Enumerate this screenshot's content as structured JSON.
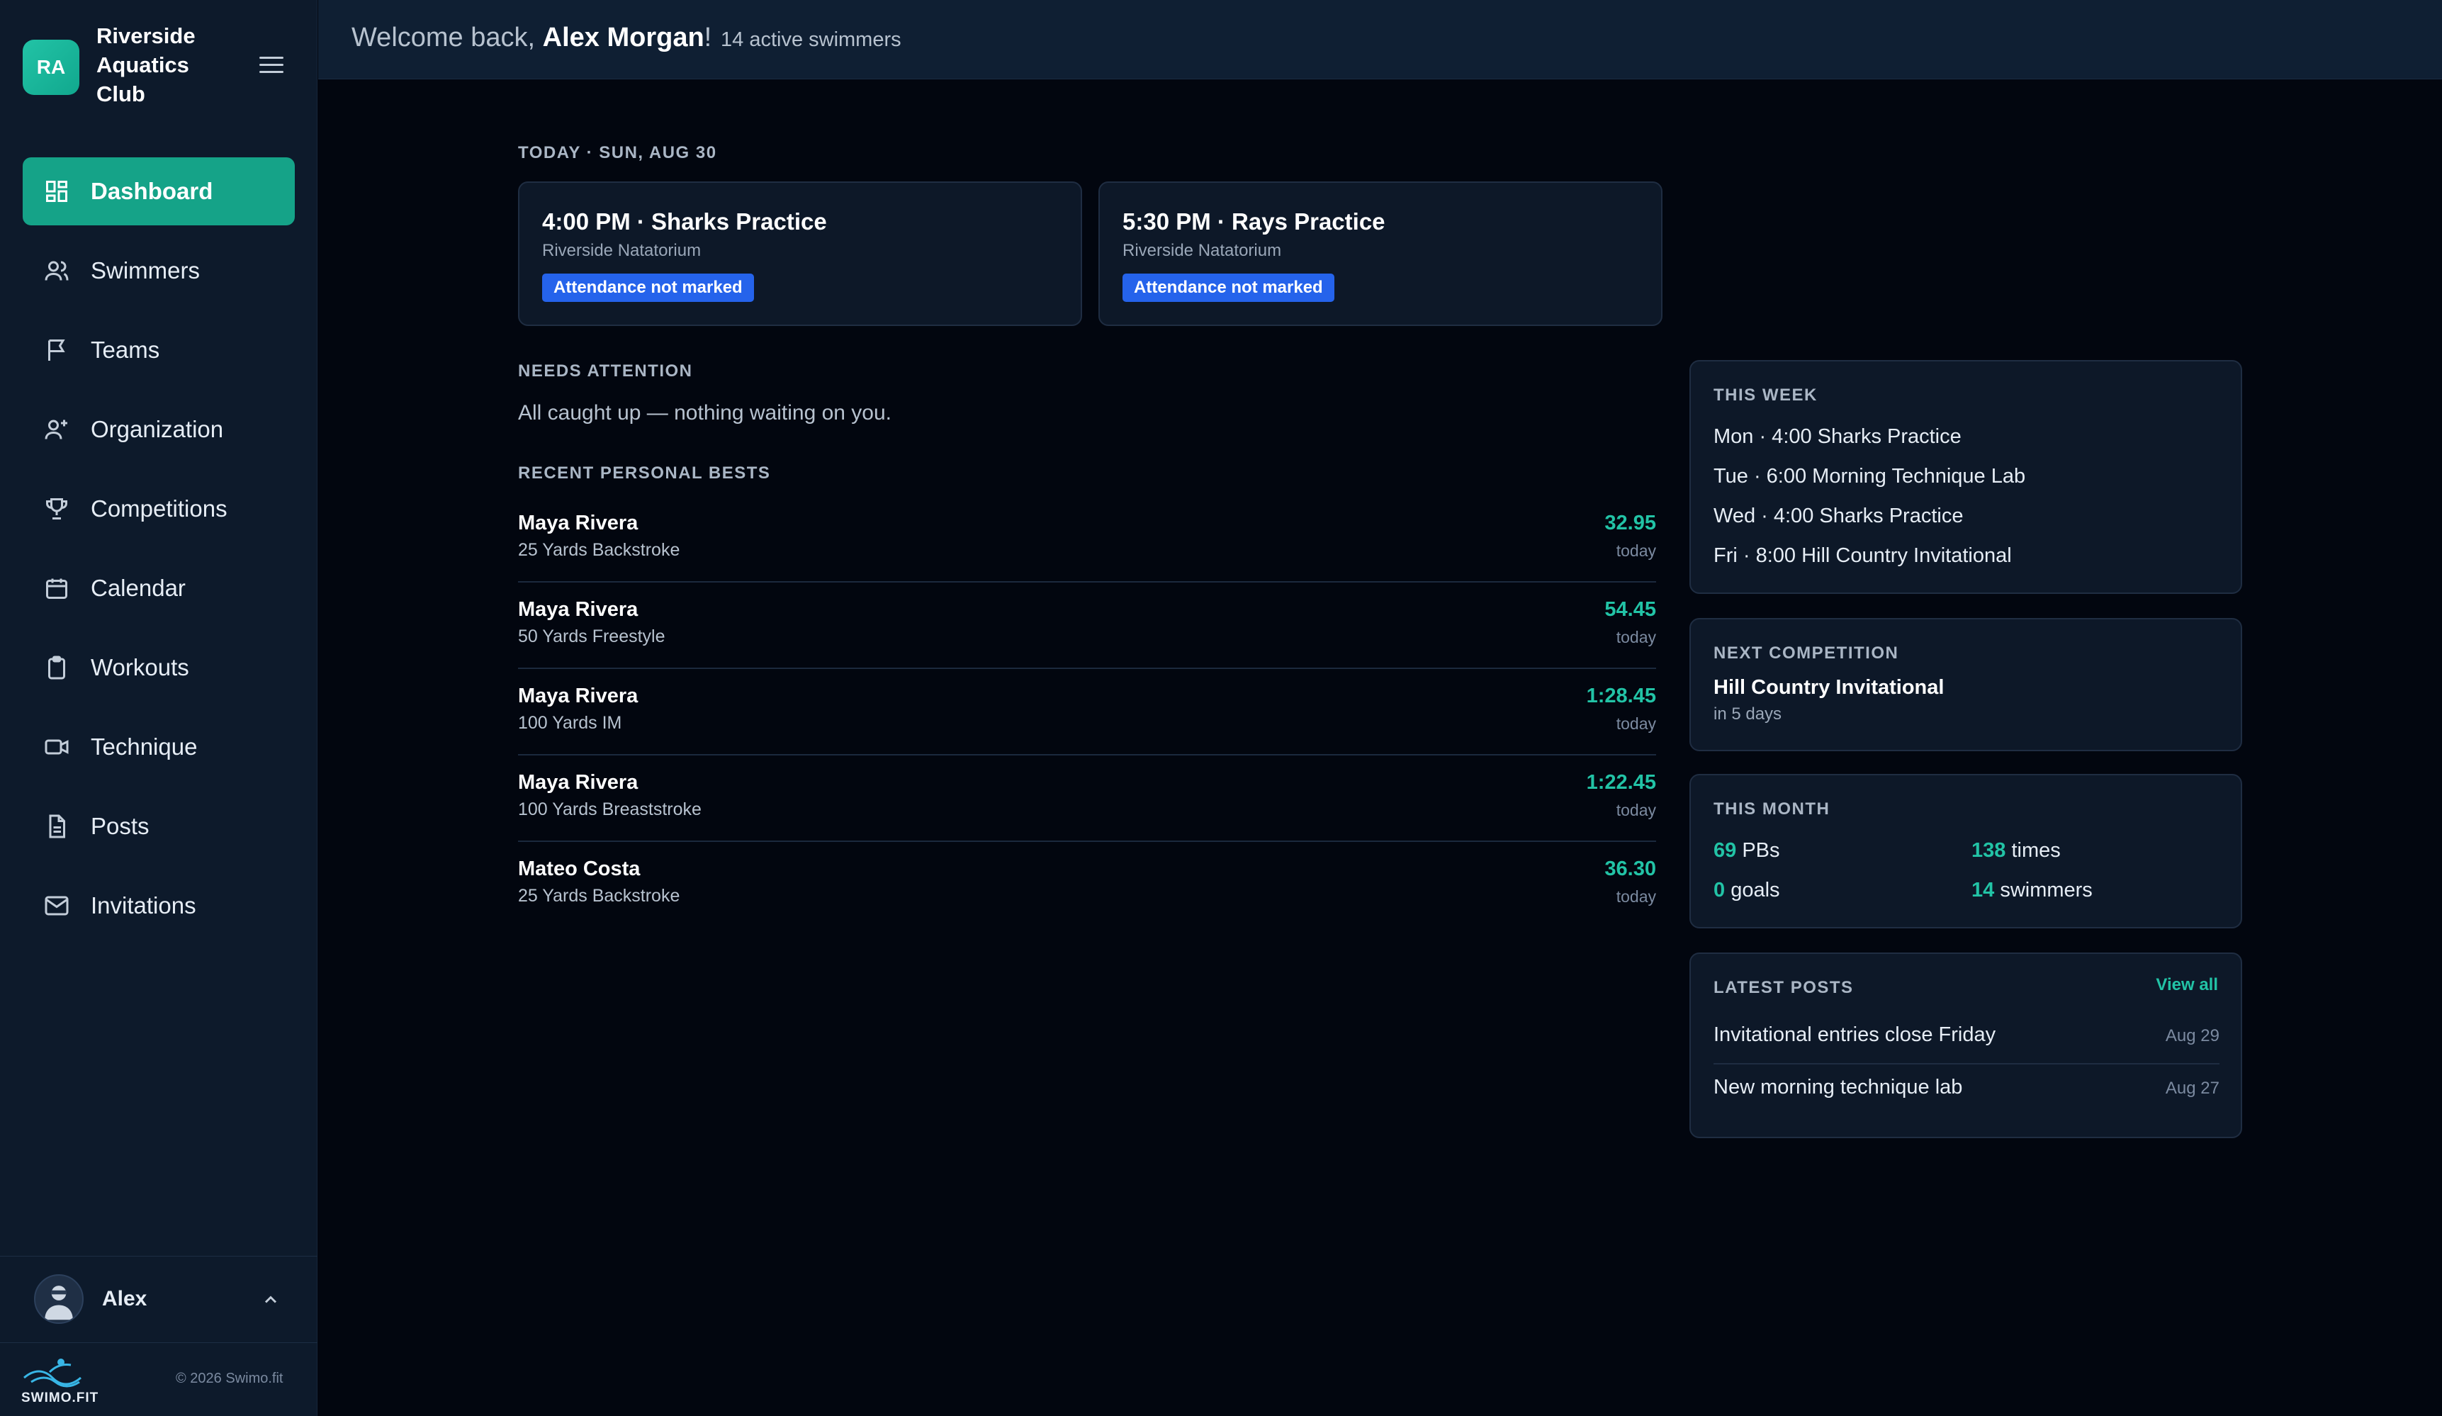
{
  "brand": {
    "initials": "RA",
    "name": "Riverside Aquatics Club"
  },
  "nav": {
    "items": [
      {
        "label": "Dashboard",
        "icon": "dashboard-icon",
        "active": true
      },
      {
        "label": "Swimmers",
        "icon": "users-icon"
      },
      {
        "label": "Teams",
        "icon": "flag-icon"
      },
      {
        "label": "Organization",
        "icon": "user-plus-icon"
      },
      {
        "label": "Competitions",
        "icon": "trophy-icon"
      },
      {
        "label": "Calendar",
        "icon": "calendar-icon"
      },
      {
        "label": "Workouts",
        "icon": "clipboard-icon"
      },
      {
        "label": "Technique",
        "icon": "video-icon"
      },
      {
        "label": "Posts",
        "icon": "file-icon"
      },
      {
        "label": "Invitations",
        "icon": "mail-icon"
      }
    ]
  },
  "user": {
    "name": "Alex"
  },
  "footer": {
    "logo_text": "SWIMO.FIT",
    "copyright": "© 2026 Swimo.fit"
  },
  "header": {
    "welcome_prefix": "Welcome back, ",
    "user_full_name": "Alex Morgan",
    "welcome_suffix": "!",
    "active_swimmers": "14 active swimmers"
  },
  "today": {
    "label": "TODAY · SUN, AUG 30",
    "practices": [
      {
        "title": "4:00 PM · Sharks Practice",
        "venue": "Riverside Natatorium",
        "badge": "Attendance not marked"
      },
      {
        "title": "5:30 PM · Rays Practice",
        "venue": "Riverside Natatorium",
        "badge": "Attendance not marked"
      }
    ]
  },
  "needs_attention": {
    "label": "NEEDS ATTENTION",
    "text": "All caught up — nothing waiting on you."
  },
  "personal_bests": {
    "label": "RECENT PERSONAL BESTS",
    "rows": [
      {
        "name": "Maya Rivera",
        "event": "25 Yards Backstroke",
        "time": "32.95",
        "when": "today"
      },
      {
        "name": "Maya Rivera",
        "event": "50 Yards Freestyle",
        "time": "54.45",
        "when": "today"
      },
      {
        "name": "Maya Rivera",
        "event": "100 Yards IM",
        "time": "1:28.45",
        "when": "today"
      },
      {
        "name": "Maya Rivera",
        "event": "100 Yards Breaststroke",
        "time": "1:22.45",
        "when": "today"
      },
      {
        "name": "Mateo Costa",
        "event": "25 Yards Backstroke",
        "time": "36.30",
        "when": "today"
      }
    ]
  },
  "this_week": {
    "label": "THIS WEEK",
    "items": [
      "Mon · 4:00 Sharks Practice",
      "Tue · 6:00 Morning Technique Lab",
      "Wed · 4:00 Sharks Practice",
      "Fri · 8:00 Hill Country Invitational"
    ]
  },
  "next_competition": {
    "label": "NEXT COMPETITION",
    "name": "Hill Country Invitational",
    "days": "in 5 days"
  },
  "this_month": {
    "label": "THIS MONTH",
    "pbs_value": "69",
    "pbs_label": " PBs",
    "times_value": "138",
    "times_label": " times",
    "goals_value": "0",
    "goals_label": " goals",
    "swimmers_value": "14",
    "swimmers_label": " swimmers"
  },
  "latest_posts": {
    "label": "LATEST POSTS",
    "view_all": "View all",
    "posts": [
      {
        "title": "Invitational entries close Friday",
        "date": "Aug 29"
      },
      {
        "title": "New morning technique lab",
        "date": "Aug 27"
      }
    ]
  },
  "colors": {
    "accent": "#22c3a6",
    "active_nav": "#15a388",
    "badge": "#2563eb"
  }
}
